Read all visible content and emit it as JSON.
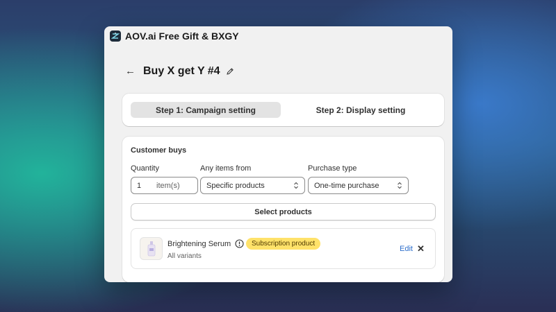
{
  "app": {
    "title": "AOV.ai Free Gift & BXGY",
    "logo_icon": "aov-logo-icon"
  },
  "page": {
    "back_icon": "←",
    "title": "Buy X get Y #4",
    "edit_icon": "pencil-icon"
  },
  "steps": [
    {
      "label": "Step 1: Campaign setting",
      "active": true
    },
    {
      "label": "Step 2: Display setting",
      "active": false
    }
  ],
  "customer_buys": {
    "title": "Customer buys",
    "quantity": {
      "label": "Quantity",
      "value": "1",
      "suffix": "item(s)"
    },
    "items_from": {
      "label": "Any items from",
      "value": "Specific products"
    },
    "purchase_type": {
      "label": "Purchase type",
      "value": "One-time purchase"
    },
    "select_products_label": "Select products",
    "products": [
      {
        "name": "Brightening Serum",
        "badge": "Subscription product",
        "variants": "All variants",
        "edit_label": "Edit",
        "remove_label": "✕"
      }
    ]
  },
  "colors": {
    "accent_link": "#2c6ecb",
    "badge_bg": "#ffe26a",
    "active_step_bg": "#e3e3e3"
  }
}
